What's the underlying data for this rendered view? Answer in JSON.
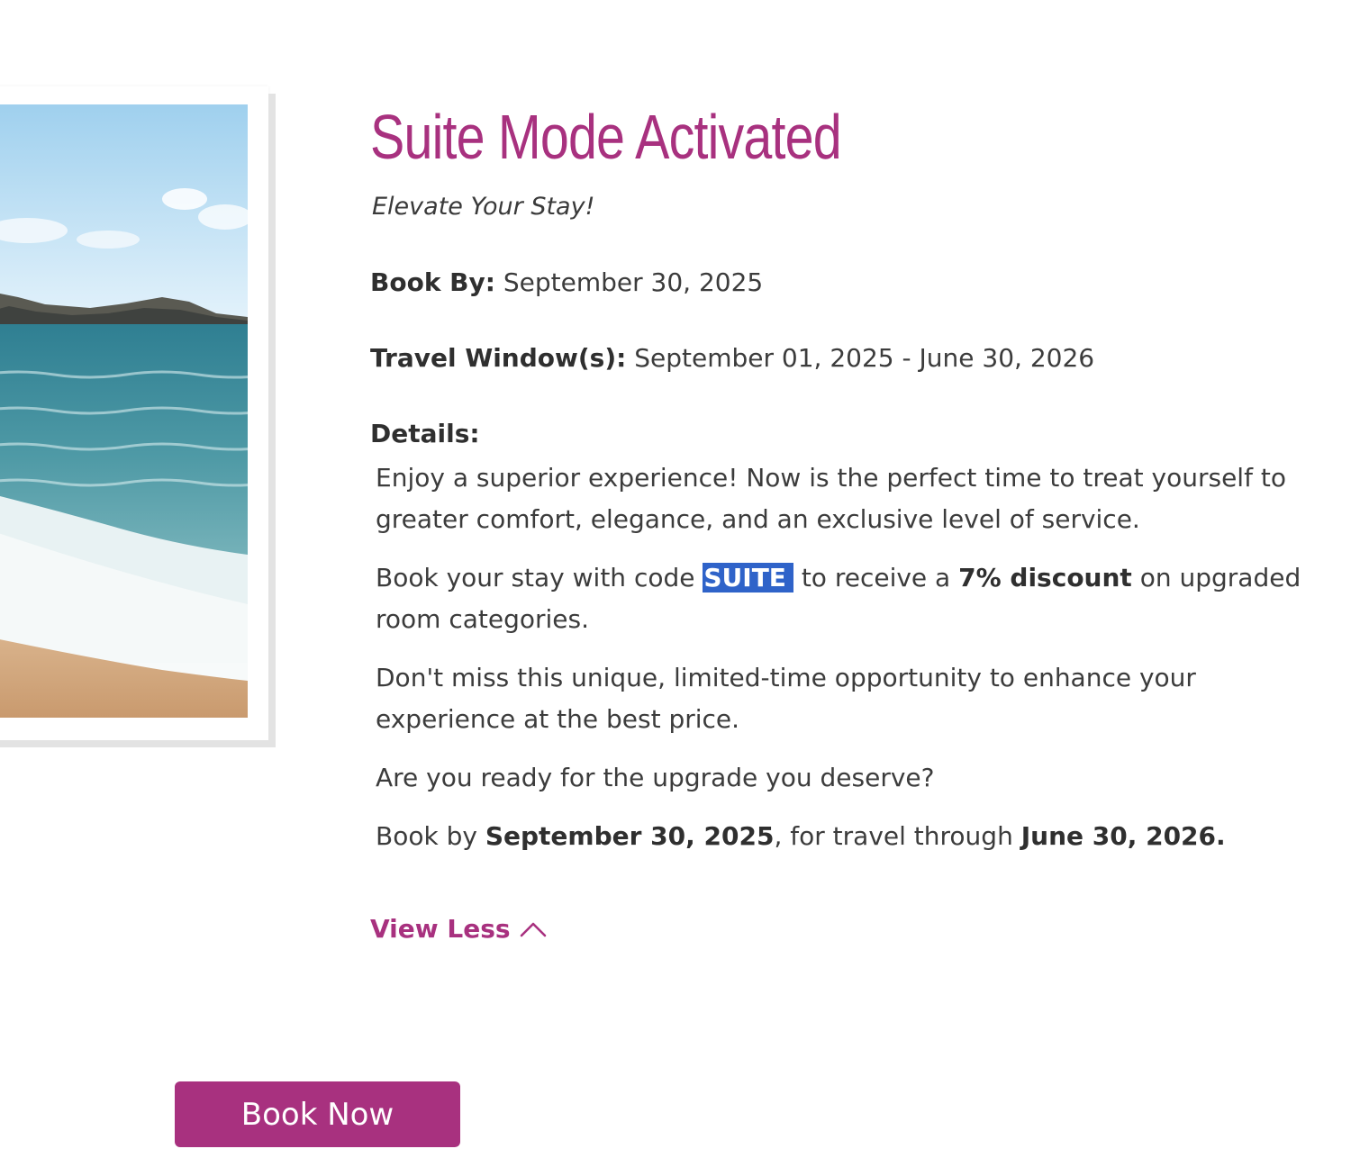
{
  "offer": {
    "title": "Suite Mode Activated",
    "subtitle": "Elevate Your Stay!",
    "book_by_label": "Book By:",
    "book_by_value": "September 30, 2025",
    "travel_window_label": "Travel Window(s):",
    "travel_window_value": "September 01, 2025 - June 30, 2026",
    "details_label": "Details:",
    "details": {
      "p1": "Enjoy a superior experience! Now is the perfect time to treat yourself to greater comfort, elegance, and an exclusive level of service.",
      "p2_pre": "Book your stay with code ",
      "p2_code": "SUITE",
      "p2_mid": " to receive a ",
      "p2_discount": "7% discount",
      "p2_post": " on upgraded room categories.",
      "p3": "Don't miss this unique, limited-time opportunity to enhance your experience at the best price.",
      "p4": "Are you ready for the upgrade you deserve?",
      "p5_pre": "Book by ",
      "p5_date1": "September 30, 2025",
      "p5_mid": ", for travel through ",
      "p5_date2": "June 30, 2026."
    },
    "view_less_label": "View Less",
    "view_less_icon": "chevron-up-icon",
    "image_subject": "beach-ocean-photo"
  },
  "book_now_label": "Book Now",
  "colors": {
    "brand": "#a8317f",
    "selection": "#2f63c9",
    "text": "#3c3c3c"
  }
}
